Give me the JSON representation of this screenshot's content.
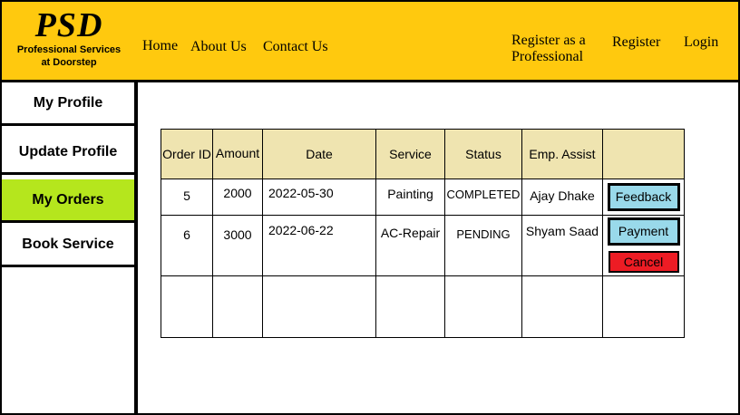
{
  "header": {
    "logo": "PSD",
    "tagline_line1": "Professional Services",
    "tagline_line2": "at Doorstep",
    "nav": {
      "home": "Home",
      "about": "About Us",
      "contact": "Contact Us",
      "register_pro_line1": "Register as a",
      "register_pro_line2": "Professional",
      "register": "Register",
      "login": "Login"
    }
  },
  "sidebar": {
    "items": [
      {
        "label": "My Profile"
      },
      {
        "label": "Update Profile"
      },
      {
        "label": "My Orders"
      },
      {
        "label": "Book Service"
      }
    ]
  },
  "orders": {
    "columns": [
      "Order ID",
      "Amount",
      "Date",
      "Service",
      "Status",
      "Emp. Assist"
    ],
    "rows": [
      {
        "id": "5",
        "amount": "2000",
        "date": "2022-05-30",
        "service": "Painting",
        "status": "COMPLETED",
        "emp": "Ajay Dhake",
        "actions": [
          "Feedback"
        ]
      },
      {
        "id": "6",
        "amount": "3000",
        "date": "2022-06-22",
        "service": "AC-Repair",
        "status": "PENDING",
        "emp": "Shyam Saad",
        "actions": [
          "Payment",
          "Cancel"
        ]
      }
    ]
  },
  "colors": {
    "header_bg": "#ffc90e",
    "active_sidebar": "#b5e61d",
    "table_header": "#efe4b0",
    "action_blue": "#99d9ea",
    "cancel_red": "#ed1c24"
  }
}
